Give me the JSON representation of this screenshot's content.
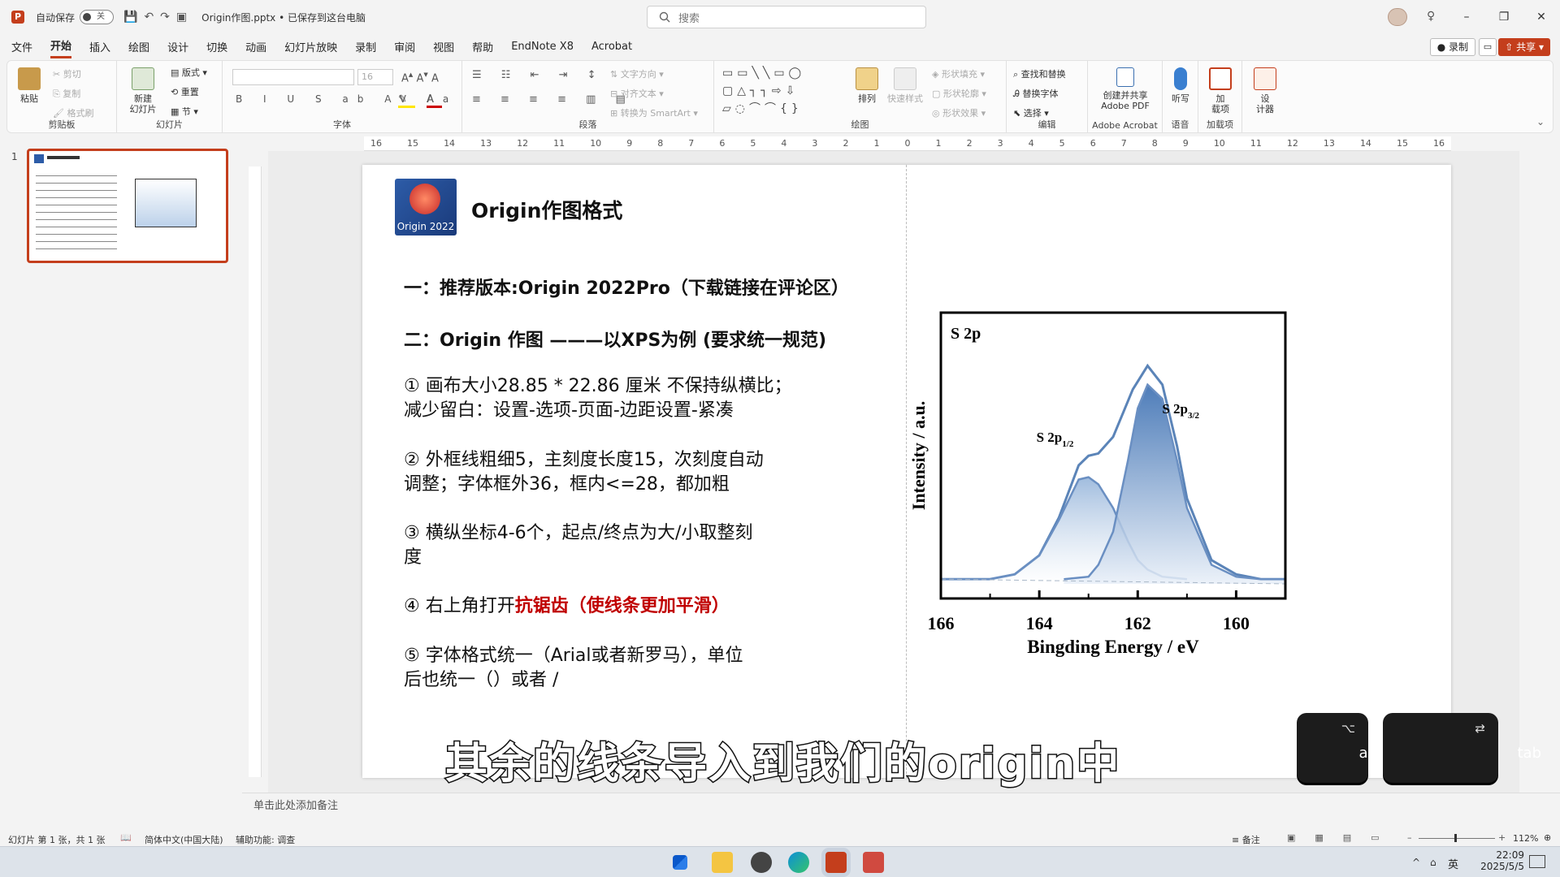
{
  "titlebar": {
    "autosave_label": "自动保存",
    "autosave_state": "关",
    "doc_title": "Origin作图.pptx • 已保存到这台电脑",
    "search_placeholder": "搜索"
  },
  "menu": {
    "tabs": [
      "文件",
      "开始",
      "插入",
      "绘图",
      "设计",
      "切换",
      "动画",
      "幻灯片放映",
      "录制",
      "审阅",
      "视图",
      "帮助",
      "EndNote X8",
      "Acrobat"
    ],
    "active": "开始",
    "record": "录制",
    "share": "共享"
  },
  "ribbon": {
    "clipboard": {
      "paste": "粘贴",
      "cut": "剪切",
      "copy": "复制",
      "format_painter": "格式刷",
      "label": "剪贴板"
    },
    "slides": {
      "new_slide": "新建\n幻灯片",
      "layout": "版式",
      "reset": "重置",
      "section": "节",
      "label": "幻灯片"
    },
    "font": {
      "size": "16",
      "label": "字体"
    },
    "paragraph": {
      "text_direction": "文字方向",
      "align_text": "对齐文本",
      "smartart": "转换为 SmartArt",
      "label": "段落"
    },
    "drawing": {
      "arrange": "排列",
      "quick_styles": "快速样式",
      "fill": "形状填充",
      "outline": "形状轮廓",
      "effects": "形状效果",
      "label": "绘图"
    },
    "editing": {
      "find": "查找和替换",
      "replace_font": "替换字体",
      "select": "选择",
      "label": "编辑"
    },
    "acrobat": {
      "create": "创建并共享\nAdobe PDF",
      "label": "Adobe Acrobat"
    },
    "voice": {
      "dictate": "听写",
      "label": "语音"
    },
    "addins": {
      "addins": "加\n载项",
      "label": "加载项"
    },
    "designer": {
      "designer": "设\n计器"
    }
  },
  "thumbnail": {
    "number": "1"
  },
  "ruler": {
    "ticks": [
      "16",
      "15",
      "14",
      "13",
      "12",
      "11",
      "10",
      "9",
      "8",
      "7",
      "6",
      "5",
      "4",
      "3",
      "2",
      "1",
      "0",
      "1",
      "2",
      "3",
      "4",
      "5",
      "6",
      "7",
      "8",
      "9",
      "10",
      "11",
      "12",
      "13",
      "14",
      "15",
      "16"
    ]
  },
  "slide": {
    "logo_text": "Origin 2022",
    "title": "Origin作图格式",
    "line1": "一：推荐版本:Origin 2022Pro（下载链接在评论区）",
    "line2": "二：Origin 作图 ———以XPS为例 (要求统一规范)",
    "item1a": "① 画布大小28.85 * 22.86 厘米 不保持纵横比；",
    "item1b": "减少留白：设置-选项-页面-边距设置-紧凑",
    "item2a": "② 外框线粗细5，主刻度长度15，次刻度自动",
    "item2b": "调整；字体框外36，框内<=28，都加粗",
    "item3a": "③ 横纵坐标4-6个，起点/终点为大/小取整刻",
    "item3b": "度",
    "item4_prefix": "④ 右上角打开",
    "item4_highlight": "抗锯齿（使线条更加平滑）",
    "item5a": "⑤ 字体格式统一（Arial或者新罗马），单位",
    "item5b": "后也统一（）或者 /"
  },
  "chart_data": {
    "type": "line",
    "title": "S 2p",
    "xlabel": "Bingding Energy / eV",
    "ylabel": "Intensity / a.u.",
    "xlim": [
      166,
      159
    ],
    "x_reversed": true,
    "xticks": [
      "166",
      "164",
      "162",
      "160"
    ],
    "peak_labels": [
      {
        "base": "S 2p",
        "sub": "1/2",
        "x": 163.2
      },
      {
        "base": "S 2p",
        "sub": "3/2",
        "x": 161.9
      }
    ],
    "series": [
      {
        "role": "envelope",
        "x": [
          166,
          165,
          164.5,
          164,
          163.6,
          163.2,
          163,
          162.8,
          162.5,
          162.1,
          161.8,
          161.5,
          161.2,
          161,
          160.5,
          160,
          159.5,
          159
        ],
        "y": [
          0.02,
          0.02,
          0.04,
          0.12,
          0.28,
          0.5,
          0.54,
          0.55,
          0.62,
          0.82,
          0.92,
          0.84,
          0.58,
          0.36,
          0.1,
          0.04,
          0.02,
          0.02
        ]
      },
      {
        "role": "peak-1",
        "x": [
          166,
          165,
          164.5,
          164,
          163.6,
          163.2,
          163,
          162.8,
          162.5,
          162.2,
          162,
          161.8,
          161.5,
          161
        ],
        "y": [
          0.02,
          0.02,
          0.04,
          0.12,
          0.27,
          0.44,
          0.45,
          0.42,
          0.32,
          0.18,
          0.1,
          0.06,
          0.03,
          0.02
        ]
      },
      {
        "role": "peak-2",
        "x": [
          163.5,
          163,
          162.8,
          162.5,
          162.2,
          162,
          161.8,
          161.5,
          161.2,
          161,
          160.5,
          160,
          159.5,
          159
        ],
        "y": [
          0.02,
          0.03,
          0.08,
          0.22,
          0.52,
          0.74,
          0.84,
          0.78,
          0.52,
          0.32,
          0.08,
          0.03,
          0.02,
          0.02
        ]
      }
    ]
  },
  "notes": {
    "placeholder": "单击此处添加备注"
  },
  "status": {
    "slide_info": "幻灯片 第 1 张，共 1 张",
    "language": "简体中文(中国大陆)",
    "accessibility": "辅助功能: 调查",
    "notes_btn": "备注",
    "zoom": "112%"
  },
  "taskbar": {
    "time": "22:09",
    "date": "2025/5/5",
    "ime": "英"
  },
  "overlay": {
    "subtitle": "其余的线条导入到我们的origin中",
    "key1": "alt",
    "key1_symbol": "⌥",
    "key2": "tab",
    "key2_symbol": "⇄"
  }
}
